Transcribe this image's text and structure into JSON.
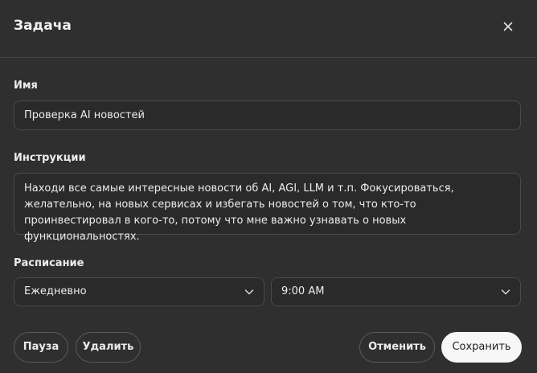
{
  "dialog": {
    "title": "Задача",
    "close_icon": "close-icon"
  },
  "name": {
    "label": "Имя",
    "value": "Проверка AI новостей"
  },
  "instructions": {
    "label": "Инструкции",
    "value": "Находи все самые интересные новости об AI, AGI, LLM и т.п. Фокусироваться, желательно, на новых сервисах и избегать новостей о том, что кто-то проинвестировал в кого-то, потому что мне важно узнавать о новых функциональностях."
  },
  "schedule": {
    "label": "Расписание",
    "frequency": "Ежедневно",
    "time": "9:00 AM",
    "chevron_icon": "chevron-down-icon"
  },
  "actions": {
    "pause": "Пауза",
    "delete": "Удалить",
    "cancel": "Отменить",
    "save": "Сохранить"
  }
}
